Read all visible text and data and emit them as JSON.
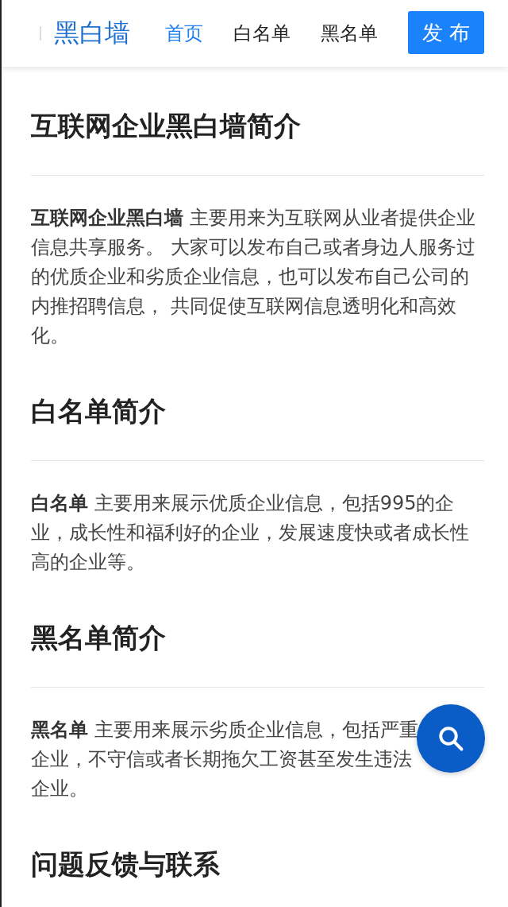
{
  "header": {
    "logo": "黑白墙",
    "nav": [
      {
        "label": "首页",
        "selected": true
      },
      {
        "label": "白名单",
        "selected": false
      },
      {
        "label": "黑名单",
        "selected": false
      }
    ],
    "publish_button": "发 布"
  },
  "sections": [
    {
      "title": "互联网企业黑白墙简介",
      "body": "**互联网企业黑白墙** 主要用来为互联网从业者提供企业信息共享服务。 大家可以发布自己或者身边人服务过的优质企业和劣质企业信息，也可以发布自己公司的内推招聘信息， 共同促使互联网信息透明化和高效化。"
    },
    {
      "title": "白名单简介",
      "body": "**白名单** 主要用来展示优质企业信息，包括995的企业，成长性和福利好的企业，发展速度快或者成长性高的企业等。"
    },
    {
      "title": "黑名单简介",
      "lines": [
        "**黑名单** 主要用来展示劣质企业信息，包括严重",
        "企业，不守信或者长期拖欠工资甚至发生违法",
        "企业。"
      ]
    },
    {
      "title": "问题反馈与联系"
    }
  ]
}
